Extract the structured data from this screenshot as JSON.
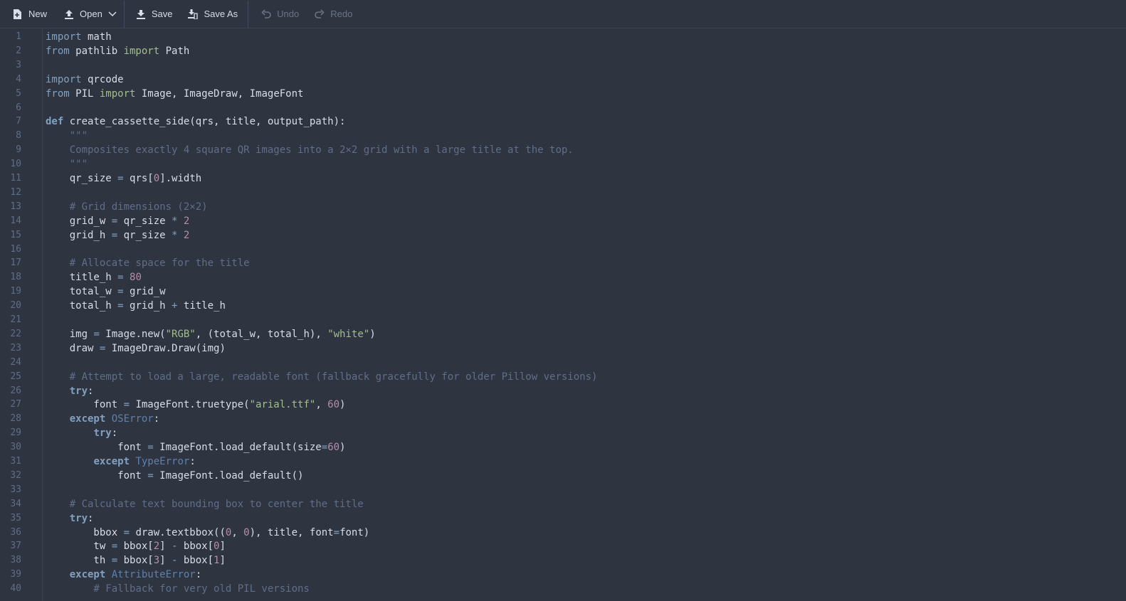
{
  "toolbar": {
    "new_label": "New",
    "open_label": "Open",
    "save_label": "Save",
    "save_as_label": "Save As",
    "undo_label": "Undo",
    "redo_label": "Redo"
  },
  "editor": {
    "lines": [
      [
        [
          "k",
          "import"
        ],
        [
          "t",
          " math"
        ]
      ],
      [
        [
          "k",
          "from"
        ],
        [
          "t",
          " pathlib "
        ],
        [
          "im",
          "import"
        ],
        [
          "t",
          " Path"
        ]
      ],
      [],
      [
        [
          "k",
          "import"
        ],
        [
          "t",
          " qrcode"
        ]
      ],
      [
        [
          "k",
          "from"
        ],
        [
          "t",
          " PIL "
        ],
        [
          "im",
          "import"
        ],
        [
          "t",
          " Image, ImageDraw, ImageFont"
        ]
      ],
      [],
      [
        [
          "kb",
          "def"
        ],
        [
          "t",
          " create_cassette_side(qrs, title, output_path):"
        ]
      ],
      [
        [
          "doc",
          "    \"\"\""
        ]
      ],
      [
        [
          "doc",
          "    Composites exactly 4 square QR images into a 2×2 grid with a large title at the top."
        ]
      ],
      [
        [
          "doc",
          "    \"\"\""
        ]
      ],
      [
        [
          "t",
          "    qr_size "
        ],
        [
          "o",
          "="
        ],
        [
          "t",
          " qrs["
        ],
        [
          "n",
          "0"
        ],
        [
          "t",
          "].width"
        ]
      ],
      [],
      [
        [
          "c",
          "    # Grid dimensions (2×2)"
        ]
      ],
      [
        [
          "t",
          "    grid_w "
        ],
        [
          "o",
          "="
        ],
        [
          "t",
          " qr_size "
        ],
        [
          "o",
          "*"
        ],
        [
          "t",
          " "
        ],
        [
          "n",
          "2"
        ]
      ],
      [
        [
          "t",
          "    grid_h "
        ],
        [
          "o",
          "="
        ],
        [
          "t",
          " qr_size "
        ],
        [
          "o",
          "*"
        ],
        [
          "t",
          " "
        ],
        [
          "n",
          "2"
        ]
      ],
      [],
      [
        [
          "c",
          "    # Allocate space for the title"
        ]
      ],
      [
        [
          "t",
          "    title_h "
        ],
        [
          "o",
          "="
        ],
        [
          "t",
          " "
        ],
        [
          "n",
          "80"
        ]
      ],
      [
        [
          "t",
          "    total_w "
        ],
        [
          "o",
          "="
        ],
        [
          "t",
          " grid_w"
        ]
      ],
      [
        [
          "t",
          "    total_h "
        ],
        [
          "o",
          "="
        ],
        [
          "t",
          " grid_h "
        ],
        [
          "o",
          "+"
        ],
        [
          "t",
          " title_h"
        ]
      ],
      [],
      [
        [
          "t",
          "    img "
        ],
        [
          "o",
          "="
        ],
        [
          "t",
          " Image.new("
        ],
        [
          "s",
          "\"RGB\""
        ],
        [
          "t",
          ", (total_w, total_h), "
        ],
        [
          "s",
          "\"white\""
        ],
        [
          "t",
          ")"
        ]
      ],
      [
        [
          "t",
          "    draw "
        ],
        [
          "o",
          "="
        ],
        [
          "t",
          " ImageDraw.Draw(img)"
        ]
      ],
      [],
      [
        [
          "c",
          "    # Attempt to load a large, readable font (fallback gracefully for older Pillow versions)"
        ]
      ],
      [
        [
          "t",
          "    "
        ],
        [
          "kb",
          "try"
        ],
        [
          "t",
          ":"
        ]
      ],
      [
        [
          "t",
          "        font "
        ],
        [
          "o",
          "="
        ],
        [
          "t",
          " ImageFont.truetype("
        ],
        [
          "s",
          "\"arial.ttf\""
        ],
        [
          "t",
          ", "
        ],
        [
          "n",
          "60"
        ],
        [
          "t",
          ")"
        ]
      ],
      [
        [
          "t",
          "    "
        ],
        [
          "kb",
          "except"
        ],
        [
          "t",
          " "
        ],
        [
          "cls",
          "OSError"
        ],
        [
          "t",
          ":"
        ]
      ],
      [
        [
          "t",
          "        "
        ],
        [
          "kb",
          "try"
        ],
        [
          "t",
          ":"
        ]
      ],
      [
        [
          "t",
          "            font "
        ],
        [
          "o",
          "="
        ],
        [
          "t",
          " ImageFont.load_default(size"
        ],
        [
          "o",
          "="
        ],
        [
          "n",
          "60"
        ],
        [
          "t",
          ")"
        ]
      ],
      [
        [
          "t",
          "        "
        ],
        [
          "kb",
          "except"
        ],
        [
          "t",
          " "
        ],
        [
          "cls",
          "TypeError"
        ],
        [
          "t",
          ":"
        ]
      ],
      [
        [
          "t",
          "            font "
        ],
        [
          "o",
          "="
        ],
        [
          "t",
          " ImageFont.load_default()"
        ]
      ],
      [],
      [
        [
          "c",
          "    # Calculate text bounding box to center the title"
        ]
      ],
      [
        [
          "t",
          "    "
        ],
        [
          "kb",
          "try"
        ],
        [
          "t",
          ":"
        ]
      ],
      [
        [
          "t",
          "        bbox "
        ],
        [
          "o",
          "="
        ],
        [
          "t",
          " draw.textbbox(("
        ],
        [
          "n",
          "0"
        ],
        [
          "t",
          ", "
        ],
        [
          "n",
          "0"
        ],
        [
          "t",
          "), title, font"
        ],
        [
          "o",
          "="
        ],
        [
          "t",
          "font)"
        ]
      ],
      [
        [
          "t",
          "        tw "
        ],
        [
          "o",
          "="
        ],
        [
          "t",
          " bbox["
        ],
        [
          "n",
          "2"
        ],
        [
          "t",
          "] "
        ],
        [
          "o",
          "-"
        ],
        [
          "t",
          " bbox["
        ],
        [
          "n",
          "0"
        ],
        [
          "t",
          "]"
        ]
      ],
      [
        [
          "t",
          "        th "
        ],
        [
          "o",
          "="
        ],
        [
          "t",
          " bbox["
        ],
        [
          "n",
          "3"
        ],
        [
          "t",
          "] "
        ],
        [
          "o",
          "-"
        ],
        [
          "t",
          " bbox["
        ],
        [
          "n",
          "1"
        ],
        [
          "t",
          "]"
        ]
      ],
      [
        [
          "t",
          "    "
        ],
        [
          "kb",
          "except"
        ],
        [
          "t",
          " "
        ],
        [
          "cls",
          "AttributeError"
        ],
        [
          "t",
          ":"
        ]
      ],
      [
        [
          "c",
          "        # Fallback for very old PIL versions"
        ]
      ]
    ]
  }
}
